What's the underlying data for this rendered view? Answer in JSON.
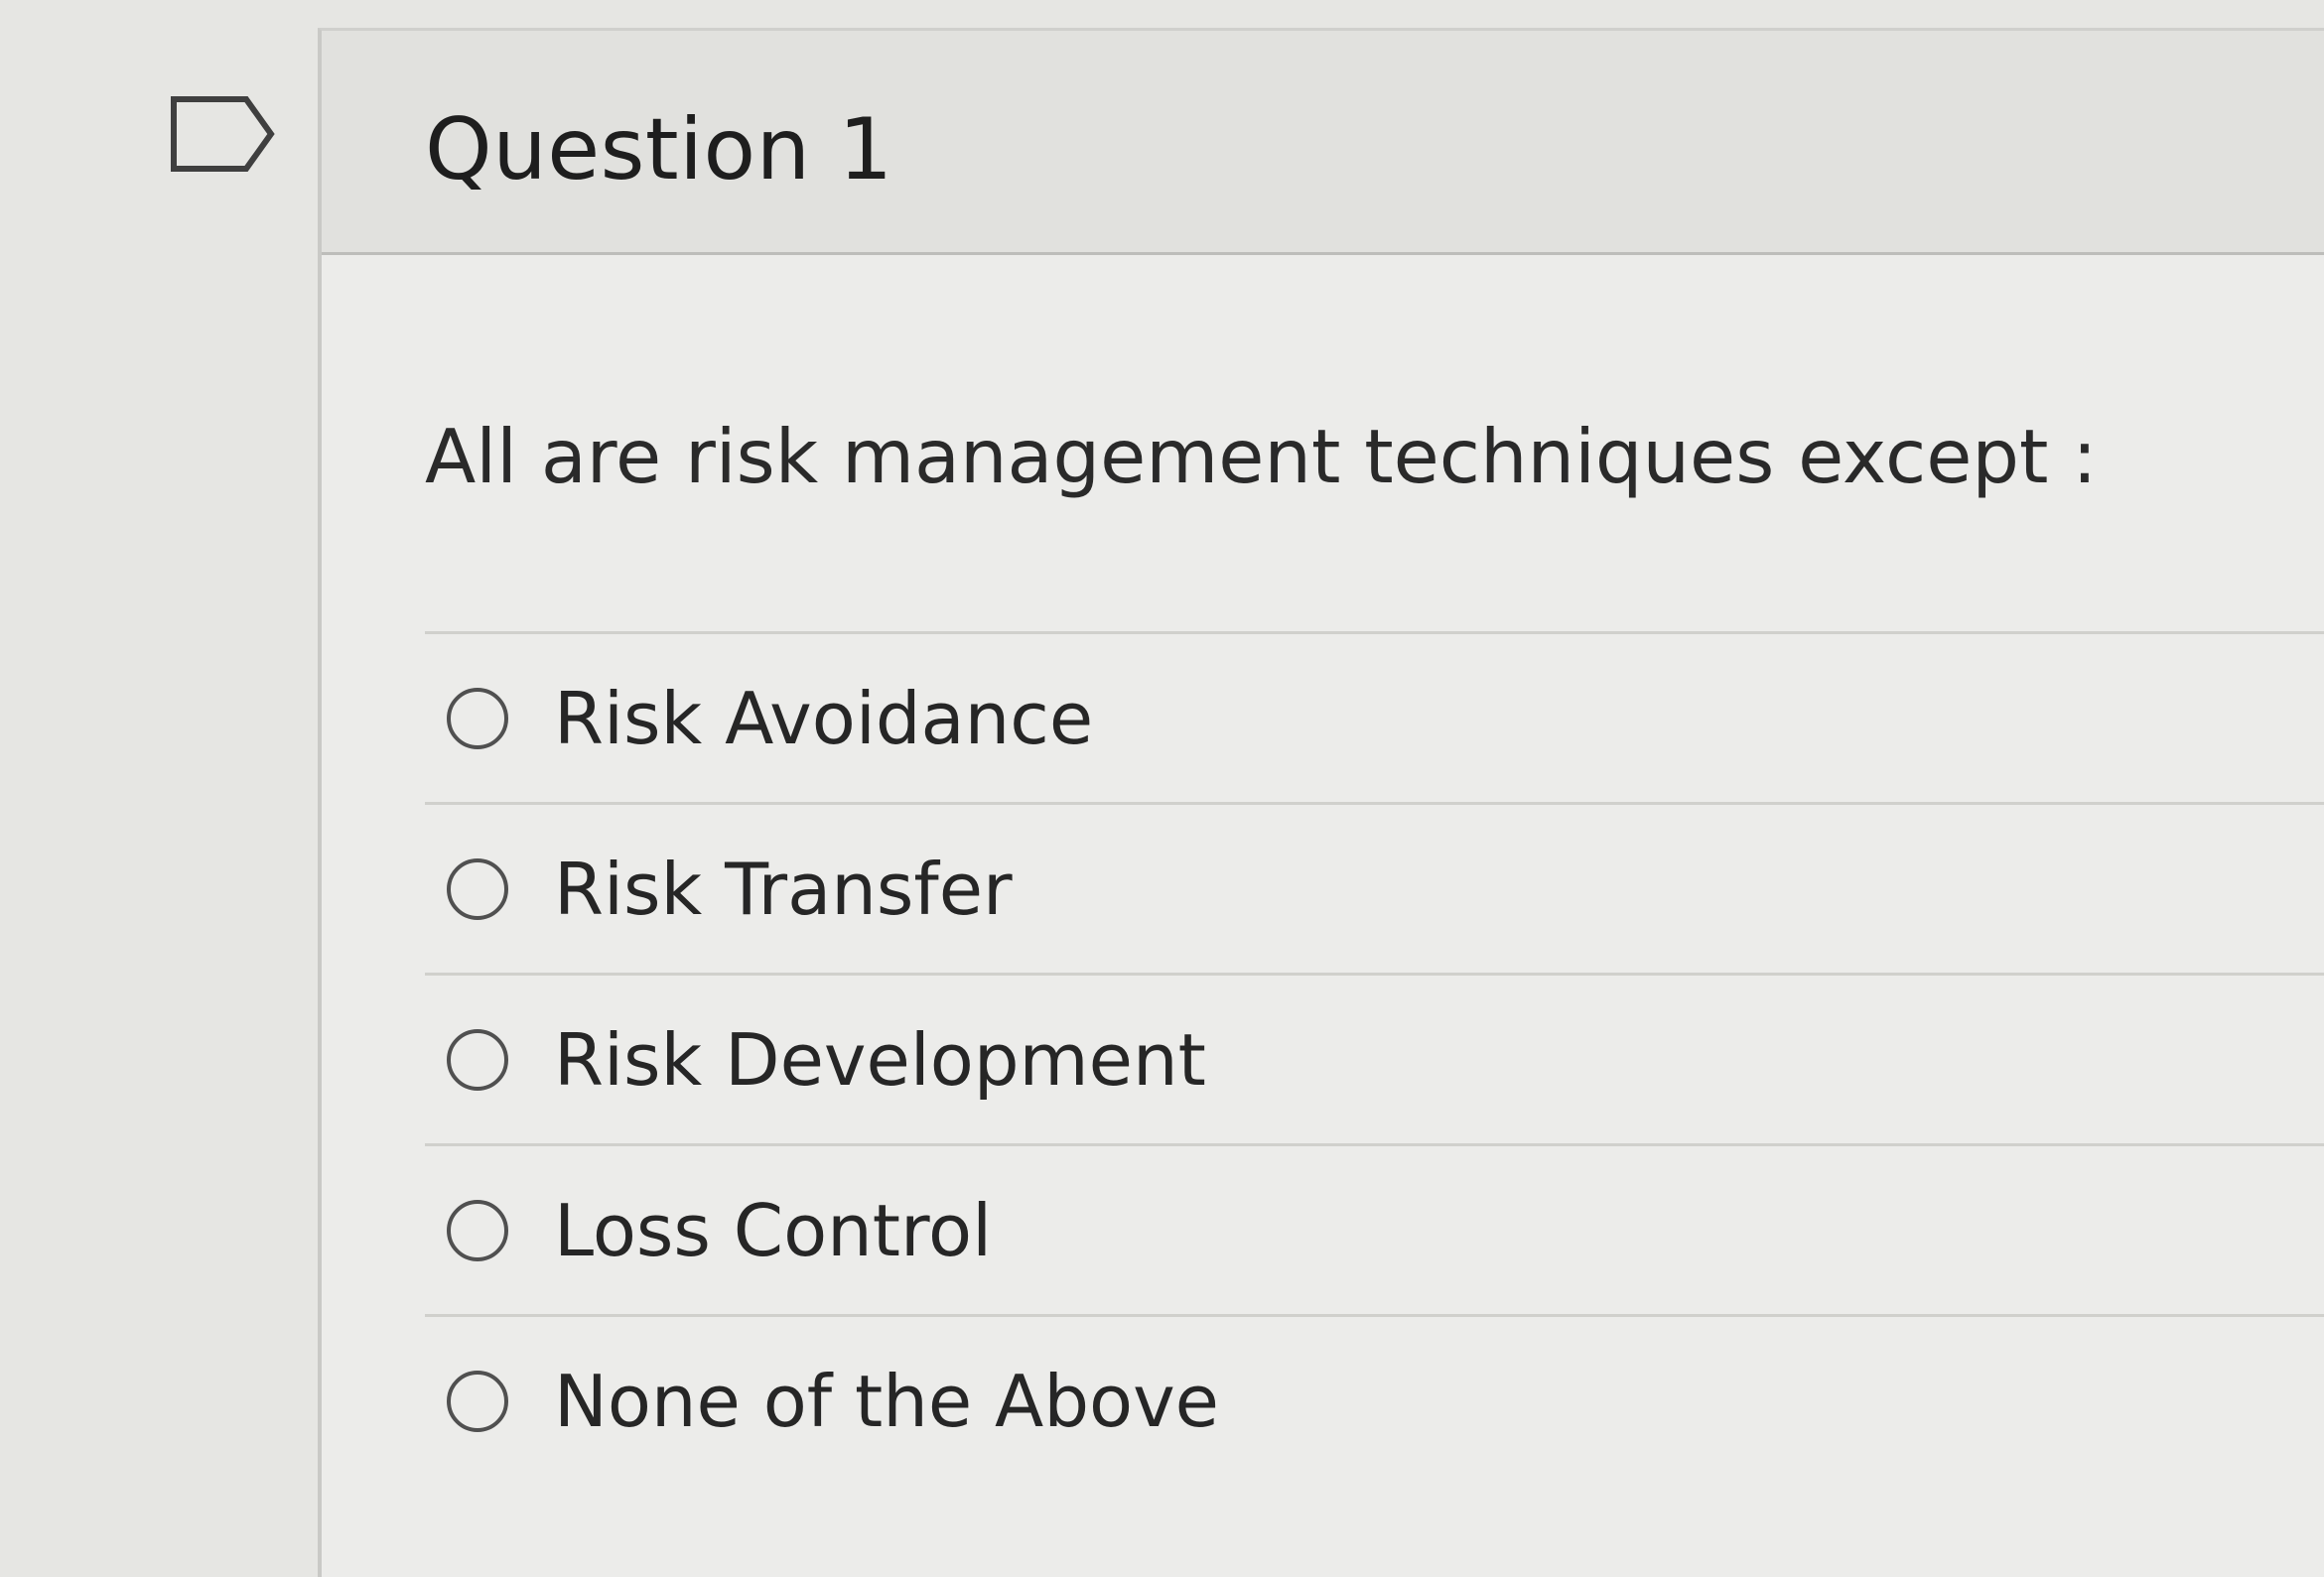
{
  "question": {
    "title": "Question 1",
    "prompt": "All are risk management techniques except :",
    "options": [
      {
        "label": "Risk Avoidance"
      },
      {
        "label": "Risk Transfer"
      },
      {
        "label": "Risk Development"
      },
      {
        "label": "Loss Control"
      },
      {
        "label": "None of the Above"
      }
    ]
  },
  "icons": {
    "flag": "flag-icon",
    "radio": "radio-unchecked-icon"
  },
  "colors": {
    "page_background": "#e6e6e3",
    "card_background": "#ececea",
    "header_background": "#e1e1de",
    "text": "#262626",
    "radio_border": "#505050"
  }
}
